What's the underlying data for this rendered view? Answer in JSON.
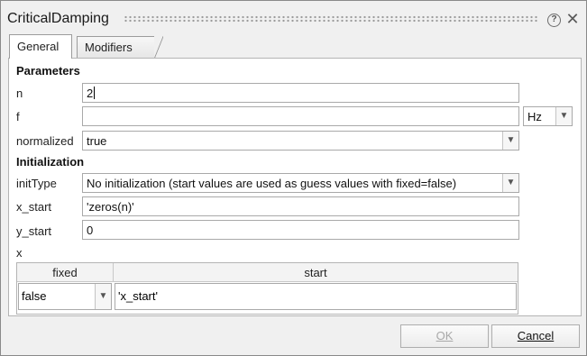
{
  "window": {
    "title": "CriticalDamping"
  },
  "tabs": [
    {
      "label": "General"
    },
    {
      "label": "Modifiers"
    }
  ],
  "parameters": {
    "section_label": "Parameters",
    "n": {
      "label": "n",
      "value": "2"
    },
    "f": {
      "label": "f",
      "value": "",
      "unit": "Hz"
    },
    "normalized": {
      "label": "normalized",
      "value": "true"
    }
  },
  "initialization": {
    "section_label": "Initialization",
    "initType": {
      "label": "initType",
      "value": "No initialization (start values are used as guess values with fixed=false)"
    },
    "x_start": {
      "label": "x_start",
      "value": "'zeros(n)'"
    },
    "y_start": {
      "label": "y_start",
      "value": "0"
    },
    "x": {
      "label": "x",
      "columns": [
        "fixed",
        "start"
      ],
      "rows": [
        {
          "fixed": "false",
          "start": "'x_start'"
        }
      ]
    }
  },
  "buttons": {
    "ok": {
      "label": "OK",
      "enabled": false
    },
    "cancel": {
      "label": "Cancel",
      "enabled": true
    }
  },
  "icons": {
    "help": "help-icon",
    "close": "close-icon",
    "dropdown": "chevron-down-icon"
  }
}
